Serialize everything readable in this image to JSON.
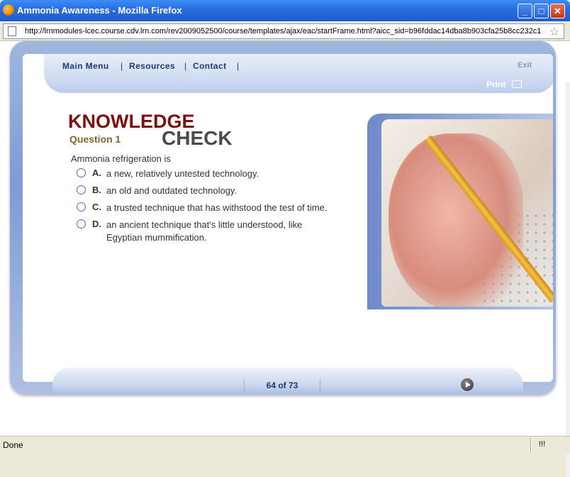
{
  "window": {
    "title": "Ammonia Awareness - Mozilla Firefox",
    "minimize": "_",
    "maximize": "□",
    "close": "✕"
  },
  "urlbar": {
    "url": "http://lrnmodules-lcec.course.cdv.lrn.com/rev2009052500/course/templates/ajax/eac/startFrame.html?aicc_sid=b96fddac14dba8b903cfa25b8cc232c1"
  },
  "nav": {
    "main_menu": "Main Menu",
    "resources": "Resources",
    "contact": "Contact",
    "separator": "|",
    "exit": "Exit",
    "print": "Print"
  },
  "knowledge_check": {
    "word1": "KNOWLEDGE",
    "word2": "CHECK",
    "question_label": "Question 1"
  },
  "question": {
    "prompt": "Ammonia refrigeration is",
    "answers": [
      {
        "letter": "A.",
        "text": "a new, relatively untested technology."
      },
      {
        "letter": "B.",
        "text": "an old and outdated technology."
      },
      {
        "letter": "C.",
        "text": "a trusted technique that has withstood the test of time."
      },
      {
        "letter": "D.",
        "text": "an ancient technique that's little understood, like Egyptian mummification."
      }
    ]
  },
  "footer": {
    "page_counter": "64 of 73"
  },
  "status": {
    "text": "Done",
    "indicator": "!!!"
  },
  "colors": {
    "knowledge": "#7a1010",
    "check": "#4a4a4a",
    "question_label": "#7a6a28",
    "nav_text": "#1c3a78"
  }
}
